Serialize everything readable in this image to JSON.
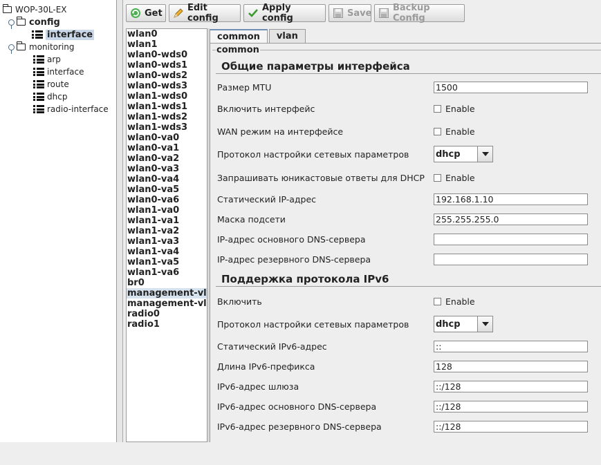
{
  "tree": {
    "root": "WOP-30L-EX",
    "config": "config",
    "interface_selected": "interface",
    "monitoring": "monitoring",
    "monitoring_items": [
      "arp",
      "interface",
      "route",
      "dhcp",
      "radio-interface"
    ]
  },
  "toolbar": {
    "get": "Get",
    "edit": "Edit config",
    "apply": "Apply config",
    "save": "Save",
    "backup": "Backup Config"
  },
  "interfaces": [
    "wlan0",
    "wlan1",
    "wlan0-wds0",
    "wlan0-wds1",
    "wlan0-wds2",
    "wlan0-wds3",
    "wlan1-wds0",
    "wlan1-wds1",
    "wlan1-wds2",
    "wlan1-wds3",
    "wlan0-va0",
    "wlan0-va1",
    "wlan0-va2",
    "wlan0-va3",
    "wlan0-va4",
    "wlan0-va5",
    "wlan0-va6",
    "wlan1-va0",
    "wlan1-va1",
    "wlan1-va2",
    "wlan1-va3",
    "wlan1-va4",
    "wlan1-va5",
    "wlan1-va6",
    "br0",
    "management-vla",
    "management-vla",
    "radio0",
    "radio1"
  ],
  "tabs": {
    "common": "common",
    "vlan": "vlan"
  },
  "group_title": "common",
  "section1": {
    "title": "Общие параметры интерфейса",
    "mtu_label": "Размер MTU",
    "mtu_value": "1500",
    "enable_iface_label": "Включить интерфейс",
    "wan_label": "WAN режим на интерфейсе",
    "proto_label": "Протокол настройки сетевых параметров",
    "proto_value": "dhcp",
    "unicast_label": "Запрашивать юникастовые ответы для DHCP",
    "static_ip_label": "Статический IP-адрес",
    "static_ip_value": "192.168.1.10",
    "mask_label": "Маска подсети",
    "mask_value": "255.255.255.0",
    "dns1_label": "IP-адрес основного DNS-сервера",
    "dns1_value": "",
    "dns2_label": "IP-адрес резервного DNS-сервера",
    "dns2_value": ""
  },
  "section2": {
    "title": "Поддержка протокола IPv6",
    "enable_label": "Включить",
    "proto_label": "Протокол настройки сетевых параметров",
    "proto_value": "dhcp",
    "static_ipv6_label": "Статический IPv6-адрес",
    "static_ipv6_value": "::",
    "prefix_label": "Длина IPv6-префикса",
    "prefix_value": "128",
    "gw_label": "IPv6-адрес шлюза",
    "gw_value": "::/128",
    "dns1_label": "IPv6-адрес основного DNS-сервера",
    "dns1_value": "::/128",
    "dns2_label": "IPv6-адрес резервного DNS-сервера",
    "dns2_value": "::/128"
  },
  "enable_text": "Enable"
}
